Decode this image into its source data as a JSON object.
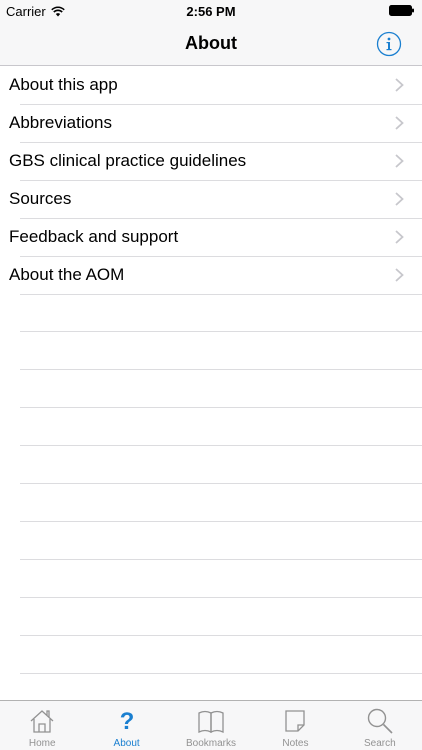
{
  "status_bar": {
    "carrier": "Carrier",
    "time": "2:56 PM",
    "icons": [
      "wifi-icon",
      "battery-icon"
    ]
  },
  "nav_bar": {
    "title": "About",
    "info_icon": "info-icon"
  },
  "menu": {
    "items": [
      {
        "label": "About this app"
      },
      {
        "label": "Abbreviations"
      },
      {
        "label": "GBS clinical practice guidelines"
      },
      {
        "label": "Sources"
      },
      {
        "label": "Feedback and support"
      },
      {
        "label": "About the AOM"
      }
    ]
  },
  "tab_bar": {
    "tabs": [
      {
        "label": "Home",
        "icon": "home-icon",
        "active": false
      },
      {
        "label": "About",
        "icon": "question-icon",
        "active": true
      },
      {
        "label": "Bookmarks",
        "icon": "book-icon",
        "active": false
      },
      {
        "label": "Notes",
        "icon": "note-icon",
        "active": false
      },
      {
        "label": "Search",
        "icon": "search-icon",
        "active": false
      }
    ]
  },
  "colors": {
    "accent": "#1a7fd0",
    "inactive": "#929292",
    "bar_background": "#f7f7f8",
    "separator": "#dcdcdf"
  }
}
